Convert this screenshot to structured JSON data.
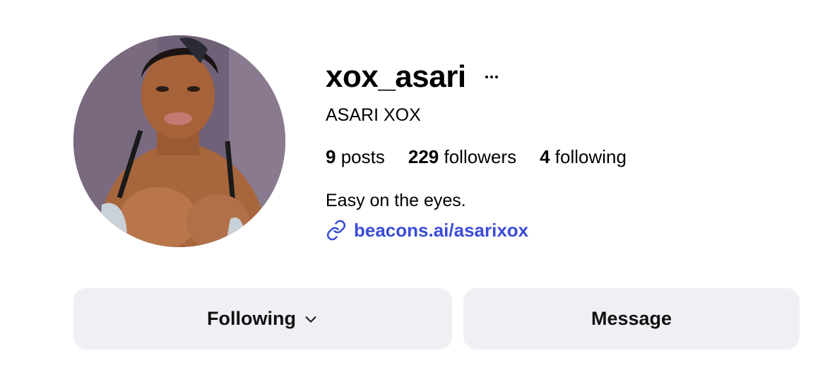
{
  "profile": {
    "username": "xox_asari",
    "full_name": "ASARI XOX",
    "bio": "Easy on the eyes.",
    "link": "beacons.ai/asarixox",
    "link_color": "#3a4cd6",
    "avatar_alt": "profile photo",
    "more_icon": "more-horizontal-icon"
  },
  "stats": {
    "posts_count": "9",
    "posts_label": "posts",
    "followers_count": "229",
    "followers_label": "followers",
    "following_count": "4",
    "following_label": "following"
  },
  "actions": {
    "following_label": "Following",
    "message_label": "Message",
    "button_bg": "#eff0f4"
  }
}
